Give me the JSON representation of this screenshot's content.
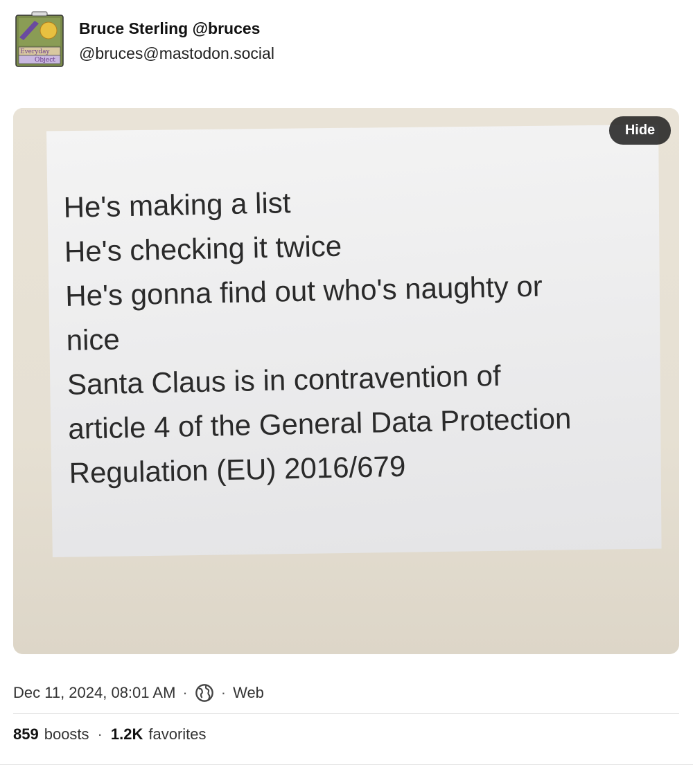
{
  "post": {
    "display_name": "Bruce Sterling @bruces",
    "account": "@bruces@mastodon.social",
    "avatar_text": [
      "Everyday",
      "Object"
    ]
  },
  "media": {
    "hide_label": "Hide",
    "sign_lines": [
      "He's making a list",
      "He's checking it twice",
      "He's gonna find out who's naughty or",
      "nice",
      "Santa Claus is in contravention of",
      "article 4 of the General Data Protection",
      "Regulation (EU) 2016/679"
    ]
  },
  "meta": {
    "timestamp": "Dec 11, 2024, 08:01 AM",
    "separator": "·",
    "visibility_icon": "globe-icon",
    "client": "Web"
  },
  "stats": {
    "boosts_count": "859",
    "boosts_label": "boosts",
    "favorites_count": "1.2K",
    "favorites_label": "favorites"
  },
  "colors": {
    "hide_button_bg": "#1e1e1e",
    "text_primary": "#111111",
    "text_secondary": "#333333"
  }
}
